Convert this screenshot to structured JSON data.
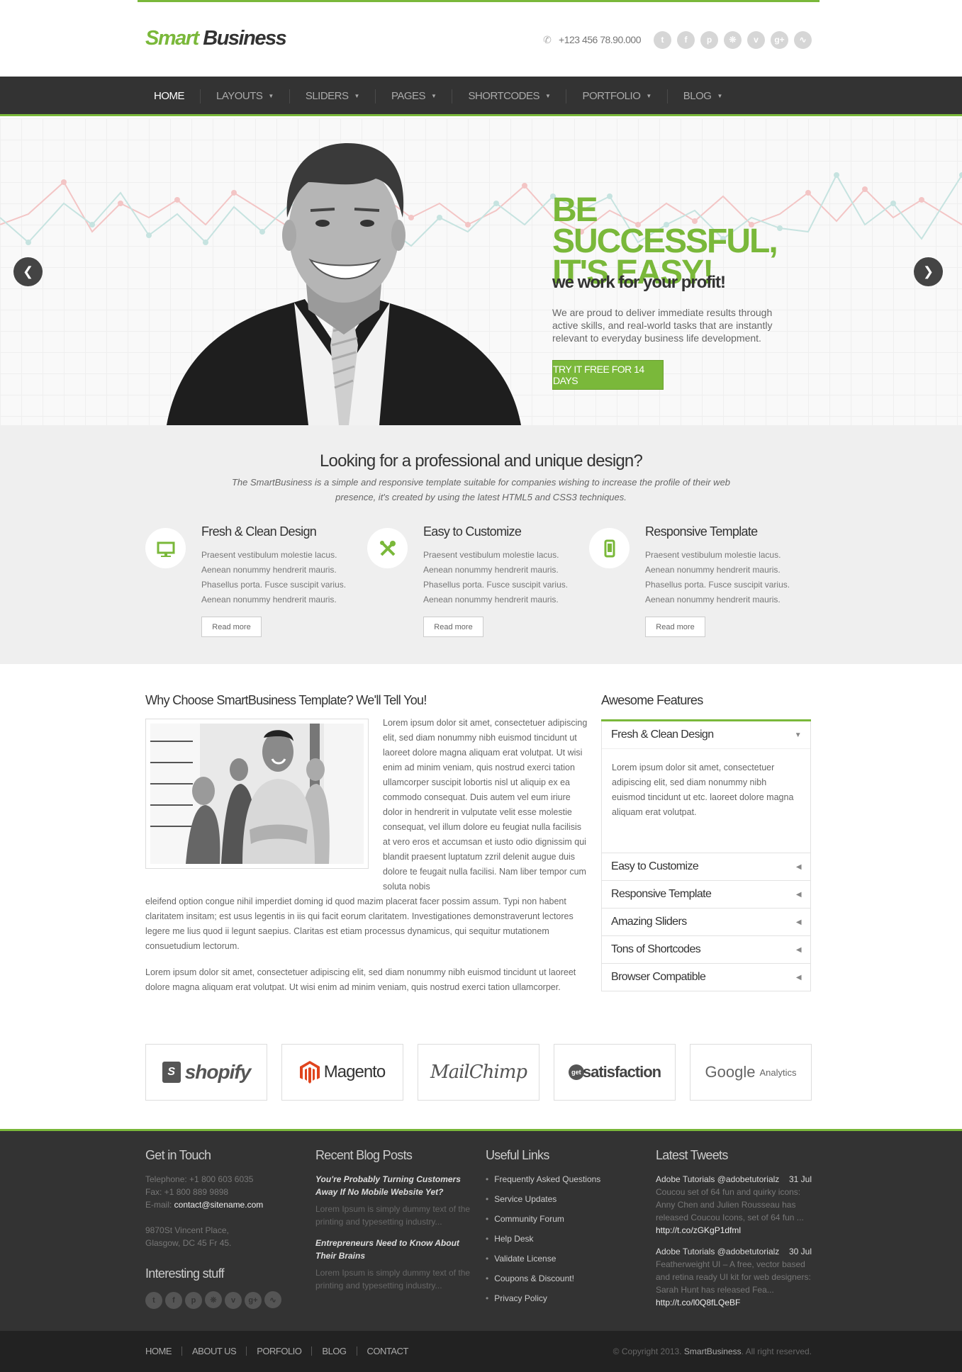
{
  "header": {
    "logo_part1": "Smart",
    "logo_part2": "Business",
    "phone": "+123 456 78.90.000",
    "social_icons": [
      "twitter-icon",
      "facebook-icon",
      "pinterest-icon",
      "dribbble-icon",
      "vimeo-icon",
      "google-plus-icon",
      "rss-icon"
    ]
  },
  "nav": {
    "items": [
      {
        "label": "HOME",
        "active": true,
        "dropdown": false
      },
      {
        "label": "LAYOUTS",
        "active": false,
        "dropdown": true
      },
      {
        "label": "SLIDERS",
        "active": false,
        "dropdown": true
      },
      {
        "label": "PAGES",
        "active": false,
        "dropdown": true
      },
      {
        "label": "SHORTCODES",
        "active": false,
        "dropdown": true
      },
      {
        "label": "PORTFOLIO",
        "active": false,
        "dropdown": true
      },
      {
        "label": "BLOG",
        "active": false,
        "dropdown": true
      }
    ]
  },
  "hero": {
    "title": "BE SUCCESSFUL, IT'S EASY!",
    "subtitle": "we work for your profit!",
    "text": "We are proud to deliver immediate results through active skills, and real-world tasks that are instantly relevant to everyday business life development.",
    "button": "TRY IT FREE FOR 14 DAYS"
  },
  "intro": {
    "title": "Looking for a professional and unique design?",
    "text": "The SmartBusiness is a simple and responsive template suitable for companies wishing to increase the profile of their web presence, it's created by using the latest HTML5 and CSS3 techniques."
  },
  "features": [
    {
      "title": "Fresh & Clean Design",
      "text": "Praesent vestibulum molestie lacus. Aenean nonummy hendrerit mauris. Phasellus porta. Fusce suscipit varius. Aenean nonummy hendrerit mauris.",
      "button": "Read more",
      "icon": "monitor-icon"
    },
    {
      "title": "Easy to Customize",
      "text": "Praesent vestibulum molestie lacus. Aenean nonummy hendrerit mauris. Phasellus porta. Fusce suscipit varius. Aenean nonummy hendrerit mauris.",
      "button": "Read more",
      "icon": "tools-icon"
    },
    {
      "title": "Responsive Template",
      "text": "Praesent vestibulum molestie lacus. Aenean nonummy hendrerit mauris. Phasellus porta. Fusce suscipit varius. Aenean nonummy hendrerit mauris.",
      "button": "Read more",
      "icon": "mobile-icon"
    }
  ],
  "why": {
    "title": "Why Choose SmartBusiness Template? We'll Tell You!",
    "para_side": "Lorem ipsum dolor sit amet, consectetuer adipiscing elit, sed diam nonummy nibh euismod tincidunt ut laoreet dolore magna aliquam erat volutpat. Ut wisi enim ad minim veniam, quis nostrud exerci tation ullamcorper suscipit lobortis nisl ut aliquip ex ea commodo consequat. Duis autem vel eum iriure dolor in hendrerit in vulputate velit esse molestie consequat, vel illum dolore eu feugiat nulla facilisis at vero eros et accumsan et iusto odio dignissim qui blandit praesent luptatum zzril delenit augue duis dolore te feugait nulla facilisi. Nam liber tempor cum soluta nobis",
    "para_full": "eleifend option congue nihil imperdiet doming id quod mazim placerat facer possim assum. Typi non habent claritatem insitam; est usus legentis in iis qui facit eorum claritatem. Investigationes demonstraverunt lectores legere me lius quod ii legunt saepius. Claritas est etiam processus dynamicus, qui sequitur mutationem consuetudium lectorum.",
    "para_2": "Lorem ipsum dolor sit amet, consectetuer adipiscing elit, sed diam nonummy nibh euismod tincidunt ut laoreet dolore magna aliquam erat volutpat. Ut wisi enim ad minim veniam, quis nostrud exerci tation ullamcorper."
  },
  "awesome": {
    "title": "Awesome Features",
    "open_item": {
      "label": "Fresh & Clean Design",
      "text": "Lorem ipsum dolor sit amet, consectetuer adipiscing elit, sed diam nonummy nibh euismod tincidunt ut etc. laoreet dolore magna aliquam erat volutpat."
    },
    "items": [
      "Easy to Customize",
      "Responsive Template",
      "Amazing Sliders",
      "Tons of Shortcodes",
      "Browser Compatible"
    ]
  },
  "partners": [
    {
      "name": "shopify"
    },
    {
      "name": "Magento"
    },
    {
      "name": "MailChimp"
    },
    {
      "name": "satisfaction",
      "prefix": "get"
    },
    {
      "name": "Google",
      "suffix": "Analytics"
    }
  ],
  "footer": {
    "contact": {
      "title": "Get in Touch",
      "telephone": "Telephone: +1 800 603 6035",
      "fax": "Fax: +1 800 889 9898",
      "email_label": "E-mail: ",
      "email": "contact@sitename.com",
      "address1": "9870St Vincent Place,",
      "address2": "Glasgow, DC 45 Fr 45."
    },
    "interesting": {
      "title": "Interesting stuff",
      "icons": [
        "t",
        "f",
        "p",
        "d",
        "v",
        "g+",
        "r"
      ]
    },
    "blog": {
      "title": "Recent Blog Posts",
      "posts": [
        {
          "title": "You're Probably Turning Customers Away If No Mobile Website Yet?",
          "excerpt": "Lorem Ipsum is simply dummy text of the printing and typesetting industry..."
        },
        {
          "title": "Entrepreneurs Need to Know About Their Brains",
          "excerpt": "Lorem Ipsum is simply dummy text of the printing and typesetting industry..."
        }
      ]
    },
    "links": {
      "title": "Useful Links",
      "items": [
        "Frequently Asked Questions",
        "Service Updates",
        "Community Forum",
        "Help Desk",
        "Validate License",
        "Coupons & Discount!",
        "Privacy Policy"
      ]
    },
    "tweets": {
      "title": "Latest Tweets",
      "items": [
        {
          "author": "Adobe Tutorials @adobetutorialz",
          "date": "31 Jul",
          "text": "Coucou set of 64 fun and quirky icons: Anny Chen and Julien Rousseau has released Coucou Icons, set of 64 fun ...",
          "link": "http://t.co/zGKgP1dfml"
        },
        {
          "author": "Adobe Tutorials @adobetutorialz",
          "date": "30 Jul",
          "text": "Featherweight UI – A free, vector based and retina ready UI kit for web designers: Sarah Hunt has released Fea...",
          "link": "http://t.co/l0Q8fLQeBF"
        }
      ]
    }
  },
  "bottom": {
    "nav": [
      "HOME",
      "ABOUT US",
      "PORFOLIO",
      "BLOG",
      "CONTACT"
    ],
    "copyright_prefix": "© Copyright 2013.",
    "copyright_brand": "SmartBusiness",
    "copyright_suffix": ". All right reserved."
  },
  "colors": {
    "accent": "#7ab83a",
    "dark": "#333333",
    "light_bg": "#efefef"
  }
}
